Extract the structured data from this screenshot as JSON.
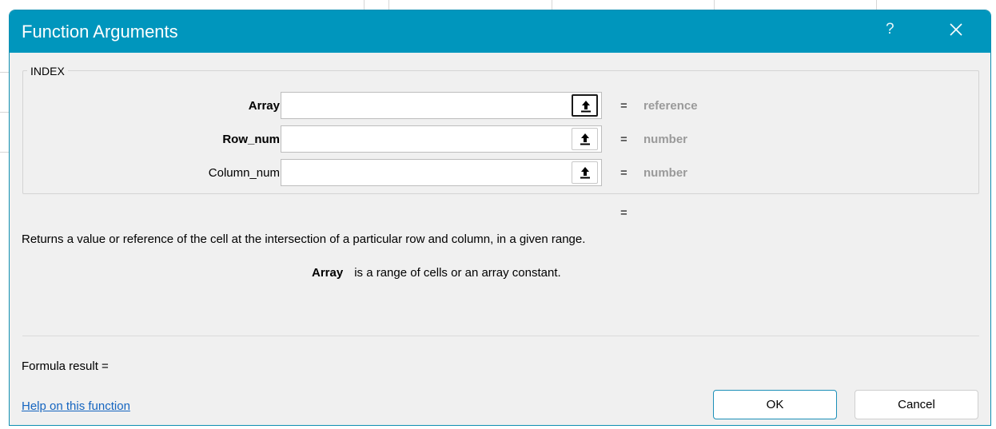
{
  "dialog": {
    "title": "Function Arguments",
    "help_glyph": "?",
    "close_icon": "close-icon",
    "function_name": "INDEX",
    "arguments": [
      {
        "label": "Array",
        "bold": true,
        "value": "",
        "type_hint": "reference",
        "icon": "collapse-dialog-icon"
      },
      {
        "label": "Row_num",
        "bold": true,
        "value": "",
        "type_hint": "number",
        "icon": "collapse-dialog-icon"
      },
      {
        "label": "Column_num",
        "bold": false,
        "value": "",
        "type_hint": "number",
        "icon": "collapse-dialog-icon"
      }
    ],
    "equals_sign": "=",
    "function_result": "",
    "description": "Returns a value or reference of the cell at the intersection of a particular row and column, in a given range.",
    "arg_help": {
      "name": "Array",
      "text": "is a range of cells or an array constant."
    },
    "formula_result_label": "Formula result =",
    "help_link": "Help on this function",
    "ok_label": "OK",
    "cancel_label": "Cancel"
  },
  "colors": {
    "titlebar": "#0096bd",
    "dialog_bg": "#f0f0f0",
    "hint_text": "#9a9a9a",
    "link": "#1565c0"
  }
}
